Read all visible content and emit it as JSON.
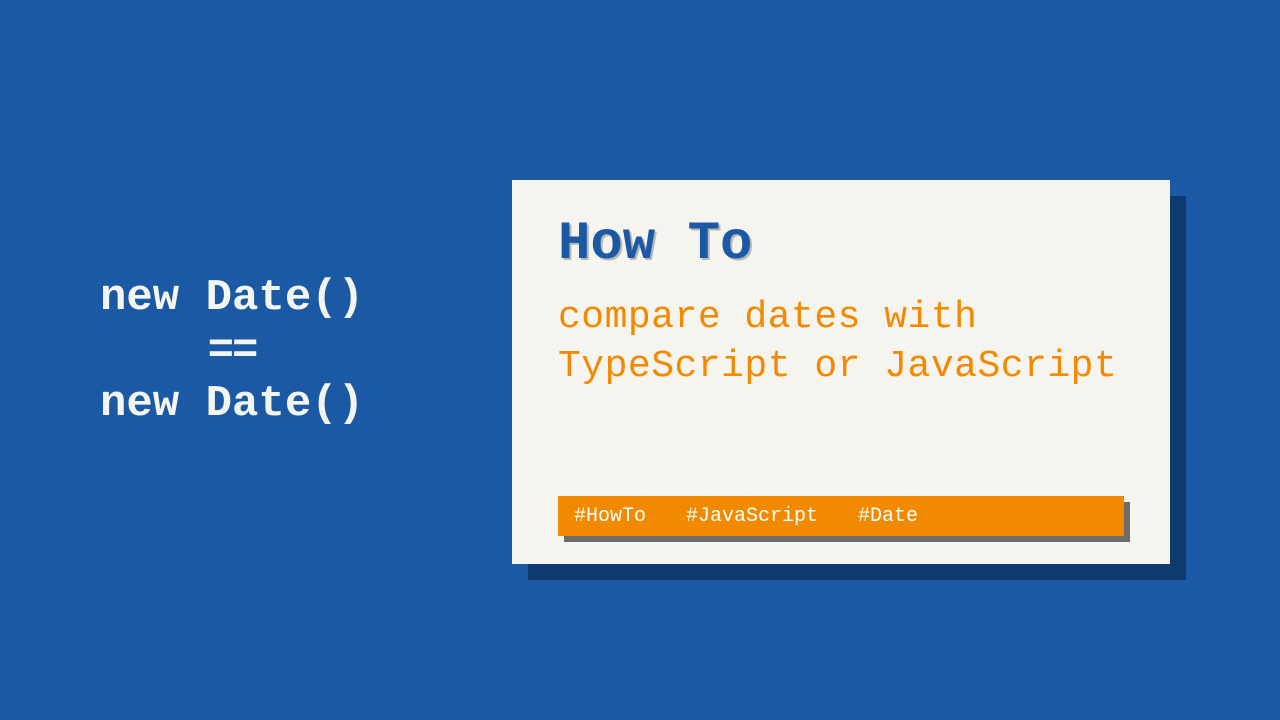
{
  "left": {
    "line1": "new Date()",
    "eq": "==",
    "line2": "new Date()"
  },
  "card": {
    "heading": "How To",
    "subtitle": "compare dates with TypeScript or JavaScript",
    "tags": {
      "t1": "#HowTo",
      "t2": "#JavaScript",
      "t3": "#Date"
    }
  }
}
